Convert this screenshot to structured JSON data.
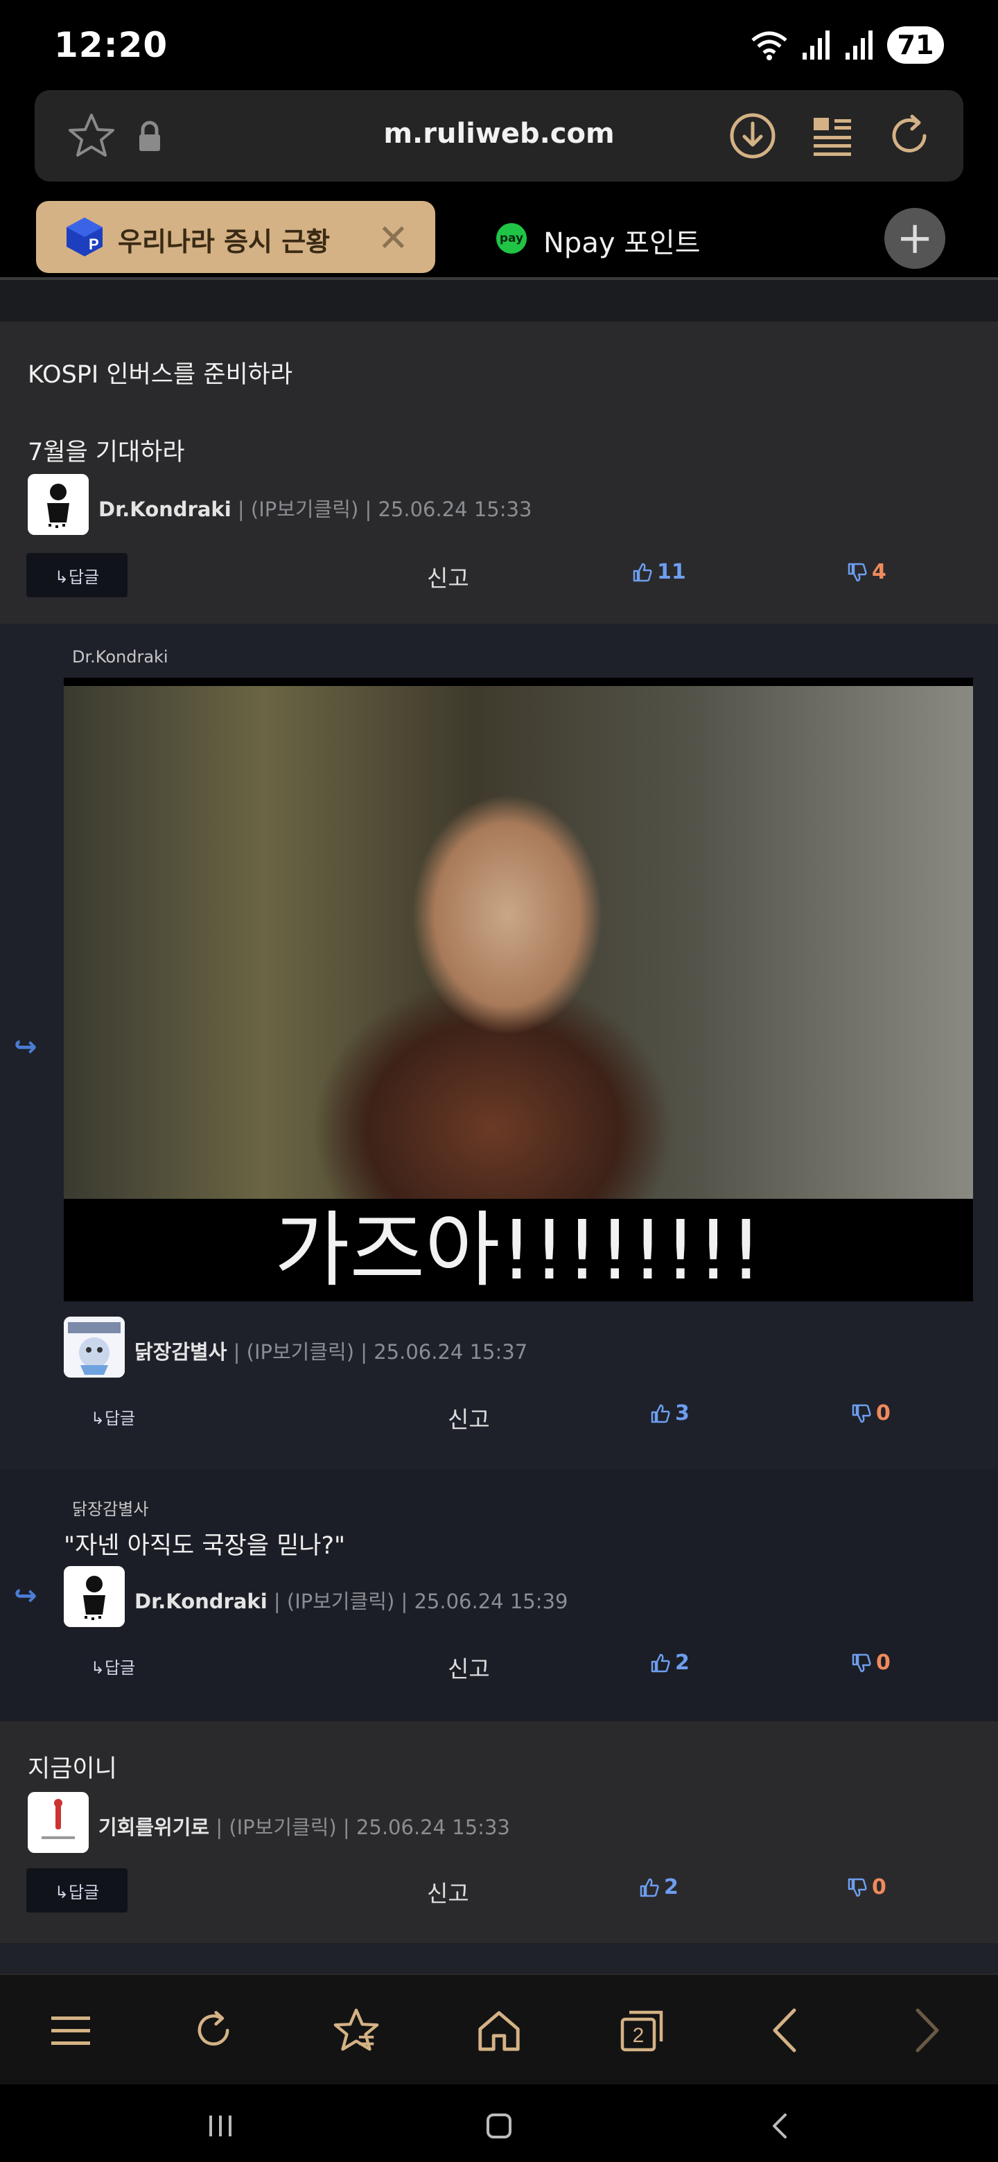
{
  "status_bar": {
    "time": "12:20",
    "battery": "71"
  },
  "browser": {
    "url": "m.ruliweb.com",
    "tabs": [
      {
        "label": "우리나라 증시 근황",
        "active": true
      },
      {
        "label": "Npay 포인트",
        "badge": "pay",
        "active": false
      }
    ]
  },
  "post_header": {
    "title": "KOSPI 인버스를 준비하라"
  },
  "comments": [
    {
      "text": "7월을 기대하라",
      "nick": "Dr.Kondraki",
      "ip_label": "(IP보기클릭)",
      "timestamp": "25.06.24 15:33",
      "reply_label": "↳답글",
      "report_label": "신고",
      "likes": "11",
      "dislikes": "4"
    },
    {
      "reply_to": "Dr.Kondraki",
      "image_caption": "가즈아!!!!!!!!",
      "nick": "닭장감별사",
      "ip_label": "(IP보기클릭)",
      "timestamp": "25.06.24 15:37",
      "reply_label": "↳답글",
      "report_label": "신고",
      "likes": "3",
      "dislikes": "0"
    },
    {
      "reply_to": "닭장감별사",
      "text": "\"자넨 아직도 국장을 믿나?\"",
      "nick": "Dr.Kondraki",
      "ip_label": "(IP보기클릭)",
      "timestamp": "25.06.24 15:39",
      "reply_label": "↳답글",
      "report_label": "신고",
      "likes": "2",
      "dislikes": "0"
    },
    {
      "text": "지금이니",
      "nick": "기회를위기로",
      "ip_label": "(IP보기클릭)",
      "timestamp": "25.06.24 15:33",
      "reply_label": "↳답글",
      "report_label": "신고",
      "likes": "2",
      "dislikes": "0"
    }
  ],
  "colors": {
    "accent_tab": "#d4b285",
    "like": "#6e9ef0",
    "dislike": "#f08a5c",
    "reply_arrow": "#4a7cd4"
  },
  "bottom_nav": {
    "tab_count": "2"
  },
  "icons": [
    "star-icon",
    "lock-icon",
    "download-icon",
    "reader-icon",
    "refresh-icon",
    "close-icon",
    "plus-icon",
    "thumbs-up-icon",
    "thumbs-down-icon",
    "reply-arrow-icon",
    "menu-icon",
    "bookmarks-icon",
    "home-icon",
    "tabs-icon",
    "back-icon",
    "forward-icon"
  ]
}
